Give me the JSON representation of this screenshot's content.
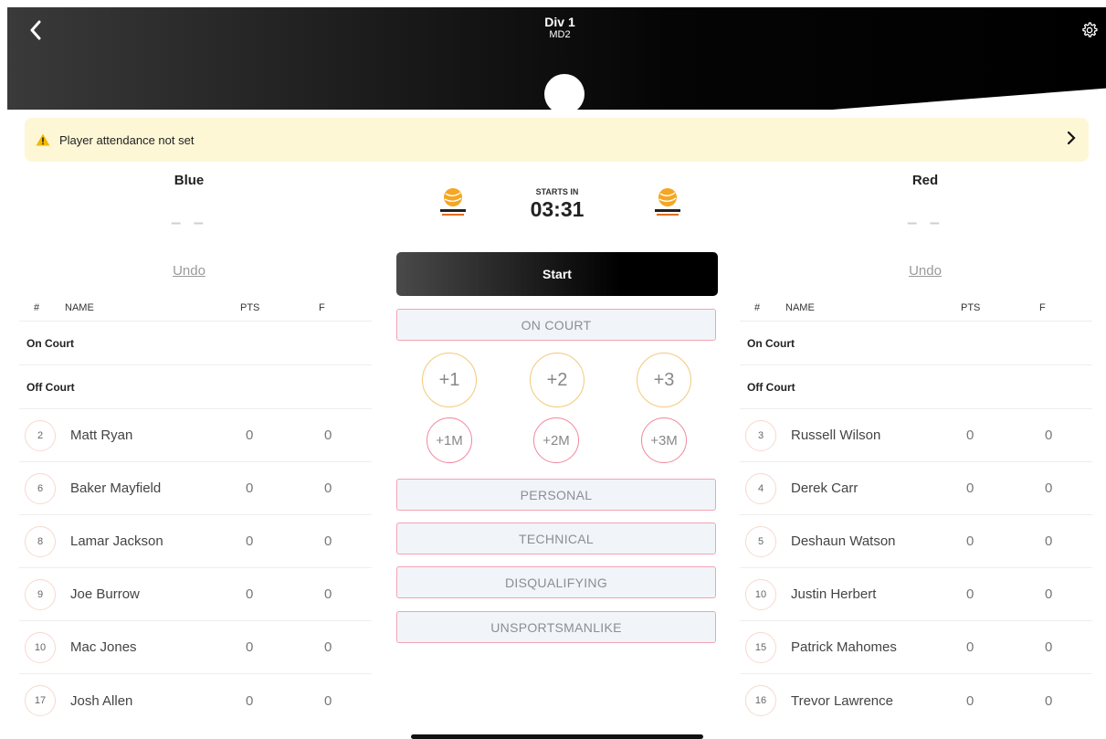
{
  "header": {
    "title": "Div 1",
    "subtitle": "MD2"
  },
  "alert": {
    "text": "Player attendance not set"
  },
  "clock": {
    "label": "STARTS IN",
    "time": "03:31"
  },
  "logo_text": "BASKETBALL QUEENSLAND",
  "start_label": "Start",
  "on_court_label": "ON COURT",
  "score_buttons": [
    "+1",
    "+2",
    "+3"
  ],
  "miss_buttons": [
    "+1M",
    "+2M",
    "+3M"
  ],
  "foul_buttons": [
    "PERSONAL",
    "TECHNICAL",
    "DISQUALIFYING",
    "UNSPORTSMANLIKE"
  ],
  "columns": {
    "num": "#",
    "name": "NAME",
    "pts": "PTS",
    "f": "F"
  },
  "sections": {
    "on_court": "On Court",
    "off_court": "Off Court"
  },
  "undo_label": "Undo",
  "home": {
    "name": "Blue",
    "score": "– –",
    "players": [
      {
        "num": "2",
        "name": "Matt Ryan",
        "pts": "0",
        "f": "0"
      },
      {
        "num": "6",
        "name": "Baker Mayfield",
        "pts": "0",
        "f": "0"
      },
      {
        "num": "8",
        "name": "Lamar Jackson",
        "pts": "0",
        "f": "0"
      },
      {
        "num": "9",
        "name": "Joe Burrow",
        "pts": "0",
        "f": "0"
      },
      {
        "num": "10",
        "name": "Mac Jones",
        "pts": "0",
        "f": "0"
      },
      {
        "num": "17",
        "name": "Josh Allen",
        "pts": "0",
        "f": "0"
      }
    ]
  },
  "away": {
    "name": "Red",
    "score": "– –",
    "players": [
      {
        "num": "3",
        "name": "Russell Wilson",
        "pts": "0",
        "f": "0"
      },
      {
        "num": "4",
        "name": "Derek Carr",
        "pts": "0",
        "f": "0"
      },
      {
        "num": "5",
        "name": "Deshaun Watson",
        "pts": "0",
        "f": "0"
      },
      {
        "num": "10",
        "name": "Justin Herbert",
        "pts": "0",
        "f": "0"
      },
      {
        "num": "15",
        "name": "Patrick Mahomes",
        "pts": "0",
        "f": "0"
      },
      {
        "num": "16",
        "name": "Trevor Lawrence",
        "pts": "0",
        "f": "0"
      }
    ]
  },
  "colors": {
    "alert_bg": "#fdf7d6",
    "accent_orange": "#f5a623",
    "accent_pink": "#f0879f"
  }
}
